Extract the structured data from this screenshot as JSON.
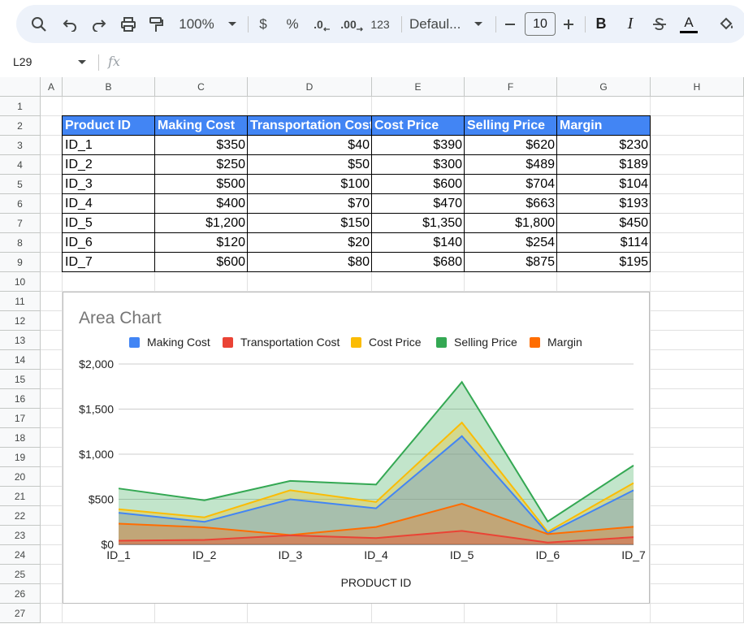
{
  "toolbar": {
    "zoom": "100%",
    "currency_symbol": "$",
    "percent_symbol": "%",
    "decrease_decimal": ".0",
    "increase_decimal": ".00",
    "number_format": "123",
    "font": "Defaul...",
    "font_size": "10",
    "bold": "B",
    "italic": "I",
    "text_color_letter": "A"
  },
  "formula_bar": {
    "name_box": "L29",
    "fx": "fx"
  },
  "columns": [
    "A",
    "B",
    "C",
    "D",
    "E",
    "F",
    "G",
    "H"
  ],
  "rows": [
    "1",
    "2",
    "3",
    "4",
    "5",
    "6",
    "7",
    "8",
    "9",
    "10",
    "11",
    "12",
    "13",
    "14",
    "15",
    "16",
    "17",
    "18",
    "19",
    "20",
    "21",
    "22",
    "23",
    "24",
    "25",
    "26",
    "27"
  ],
  "table": {
    "headers": [
      "Product ID",
      "Making Cost",
      "Transportation Cost",
      "Cost Price",
      "Selling Price",
      "Margin"
    ],
    "rows": [
      [
        "ID_1",
        "$350",
        "$40",
        "$390",
        "$620",
        "$230"
      ],
      [
        "ID_2",
        "$250",
        "$50",
        "$300",
        "$489",
        "$189"
      ],
      [
        "ID_3",
        "$500",
        "$100",
        "$600",
        "$704",
        "$104"
      ],
      [
        "ID_4",
        "$400",
        "$70",
        "$470",
        "$663",
        "$193"
      ],
      [
        "ID_5",
        "$1,200",
        "$150",
        "$1,350",
        "$1,800",
        "$450"
      ],
      [
        "ID_6",
        "$120",
        "$20",
        "$140",
        "$254",
        "$114"
      ],
      [
        "ID_7",
        "$600",
        "$80",
        "$680",
        "$875",
        "$195"
      ]
    ]
  },
  "chart_data": {
    "type": "area",
    "title": "Area Chart",
    "xlabel": "PRODUCT ID",
    "ylabel": "",
    "categories": [
      "ID_1",
      "ID_2",
      "ID_3",
      "ID_4",
      "ID_5",
      "ID_6",
      "ID_7"
    ],
    "ylim": [
      0,
      2000
    ],
    "yticks": [
      0,
      500,
      1000,
      1500,
      2000
    ],
    "ytick_labels": [
      "$0",
      "$500",
      "$1,000",
      "$1,500",
      "$2,000"
    ],
    "grid": true,
    "legend_position": "top",
    "series": [
      {
        "name": "Making Cost",
        "color": "#4285f4",
        "values": [
          350,
          250,
          500,
          400,
          1200,
          120,
          600
        ]
      },
      {
        "name": "Transportation Cost",
        "color": "#ea4335",
        "values": [
          40,
          50,
          100,
          70,
          150,
          20,
          80
        ]
      },
      {
        "name": "Cost Price",
        "color": "#fbbc04",
        "values": [
          390,
          300,
          600,
          470,
          1350,
          140,
          680
        ]
      },
      {
        "name": "Selling Price",
        "color": "#34a853",
        "values": [
          620,
          489,
          704,
          663,
          1800,
          254,
          875
        ]
      },
      {
        "name": "Margin",
        "color": "#ff6d01",
        "values": [
          230,
          189,
          104,
          193,
          450,
          114,
          195
        ]
      }
    ]
  }
}
